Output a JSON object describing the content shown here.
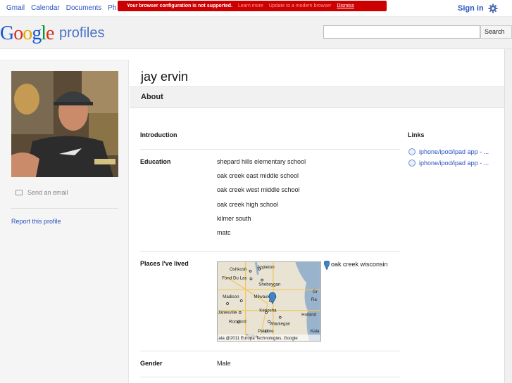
{
  "topnav": {
    "items": [
      "Gmail",
      "Calendar",
      "Documents",
      "Ph"
    ]
  },
  "banner": {
    "message": "Your browser configuration is not supported.",
    "learn_more": "Learn more",
    "update": "Update to a modern browser",
    "dismiss": "Dismiss"
  },
  "account": {
    "sign_in": "Sign in",
    "settings_icon": "gear-icon"
  },
  "header": {
    "product": "profiles",
    "search_button": "Search",
    "search_value": ""
  },
  "profile": {
    "name": "jay ervin",
    "send_email": "Send an email",
    "report": "Report this profile"
  },
  "about": {
    "title": "About",
    "introduction_label": "Introduction",
    "education_label": "Education",
    "education": [
      "shepard hills elementary school",
      "oak creek east middle school",
      "oak creek west middle school",
      "oak creek high school",
      "kilmer south",
      "matc"
    ],
    "places_label": "Places I've lived",
    "place": "oak creek wisconsin",
    "gender_label": "Gender",
    "gender": "Male"
  },
  "links": {
    "title": "Links",
    "items": [
      "iphone/ipod/ipad app - ...",
      "iphone/ipod/ipad app - ..."
    ]
  },
  "map": {
    "cities": [
      "Oshkosh",
      "Appleton",
      "Fond Du Lac",
      "Sheboygan",
      "Madison",
      "Milwaukee",
      "Kenosha",
      "Holland",
      "Janesville",
      "Rockford",
      "Waukegan",
      "Palatine",
      "Elgin",
      "Gr",
      "Ra",
      "Kala"
    ],
    "attribution": "ata @2011 Europa Technologies, Google"
  },
  "colors": {
    "link": "#2a52be",
    "banner": "#cc0000",
    "background_left": "#f5f5f5"
  }
}
